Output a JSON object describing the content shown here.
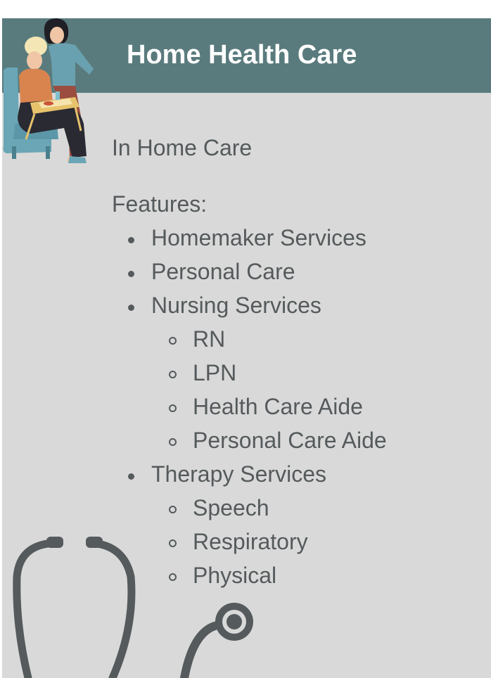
{
  "header": {
    "title": "Home Health Care"
  },
  "subtitle": "In Home Care",
  "features": {
    "label": "Features:",
    "items": [
      {
        "label": "Homemaker Services",
        "subitems": []
      },
      {
        "label": "Personal Care",
        "subitems": []
      },
      {
        "label": "Nursing Services",
        "subitems": [
          "RN",
          "LPN",
          "Health Care Aide",
          "Personal Care Aide"
        ]
      },
      {
        "label": "Therapy Services",
        "subitems": [
          "Speech",
          "Respiratory",
          "Physical"
        ]
      }
    ]
  },
  "colors": {
    "header_bg": "#5a7b7d",
    "card_bg": "#d9d9d9",
    "text": "#555a5c",
    "stethoscope": "#555a5c"
  },
  "icons": [
    "caregiver-illustration-icon",
    "stethoscope-icon"
  ]
}
